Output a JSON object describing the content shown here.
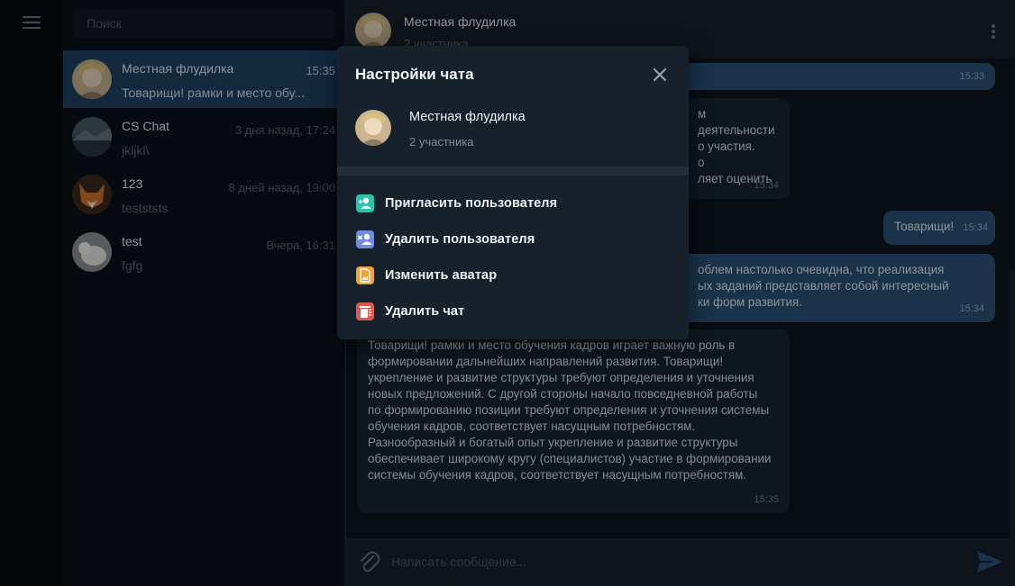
{
  "sidebar": {
    "menu_icon": "hamburger-menu-icon"
  },
  "search": {
    "placeholder": "Поиск"
  },
  "chats": [
    {
      "name": "Местная флудилка",
      "time": "15:35",
      "preview": "Товарищи! рамки и место обу...",
      "active": true
    },
    {
      "name": "CS Chat",
      "time": "3 дня назад, 17:24",
      "preview": "jkljkl\\",
      "active": false
    },
    {
      "name": "123",
      "time": "8 дней назад, 19:00",
      "preview": "testststs",
      "active": false
    },
    {
      "name": "test",
      "time": "Вчера, 16:31",
      "preview": "fgfg",
      "active": false
    }
  ],
  "header": {
    "title": "Местная флудилка",
    "subtitle": "2 участника",
    "menu_icon": "kebab-menu-icon"
  },
  "messages": [
    {
      "dir": "out",
      "text": "",
      "time": "15:33"
    },
    {
      "dir": "in",
      "lines": [
        "м деятельности",
        "о участия.",
        "о",
        "ляет оценить"
      ],
      "time": "15:34"
    },
    {
      "dir": "out",
      "text": "Товарищи!",
      "time": "15:34"
    },
    {
      "dir": "out",
      "lines": [
        "облем настолько очевидна, что реализация",
        "ых заданий представляет собой интересный",
        "ки форм развития."
      ],
      "time": "15:34"
    },
    {
      "dir": "in",
      "lines": [
        "Товарищи! рамки и место обучения кадров играет важную роль в",
        "формировании дальнейших направлений развития. Товарищи!",
        "укрепление и развитие структуры требуют определения и уточнения",
        "новых предложений. С другой стороны начало повседневной работы",
        "по формированию позиции требуют определения и уточнения системы",
        "обучения кадров, соответствует насущным потребностям.",
        "Разнообразный и богатый опыт укрепление и развитие структуры",
        "обеспечивает широкому кругу (специалистов) участие в формировании",
        "системы обучения кадров, соответствует насущным потребностям."
      ],
      "time": "15:35"
    }
  ],
  "composer": {
    "placeholder": "Написать сообщение...",
    "attach_icon": "paperclip-icon",
    "send_icon": "send-icon"
  },
  "modal": {
    "title": "Настройки чата",
    "close_icon": "close-icon",
    "chat_name": "Местная флудилка",
    "chat_members": "2 участника",
    "actions": [
      {
        "label": "Пригласить пользователя",
        "icon": "add-user-icon",
        "color": "#2ac3ad"
      },
      {
        "label": "Удалить пользователя",
        "icon": "remove-user-icon",
        "color": "#6f8cdc"
      },
      {
        "label": "Изменить аватар",
        "icon": "image-file-icon",
        "color": "#f0a232"
      },
      {
        "label": "Удалить чат",
        "icon": "trash-icon",
        "color": "#e0584f"
      }
    ]
  },
  "colors": {
    "accent": "#2b5278",
    "active_chat": "#1e4364",
    "background": "#0e1621",
    "panel": "#17212b"
  }
}
